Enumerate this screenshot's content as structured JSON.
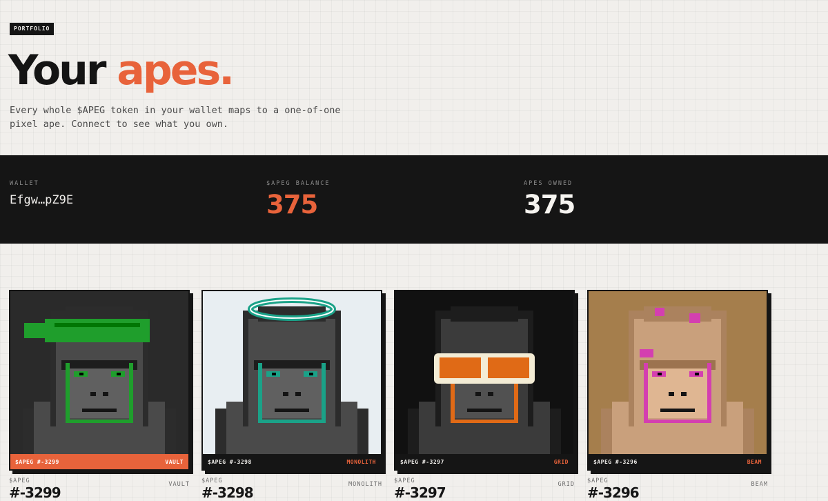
{
  "header": {
    "badge": "PORTFOLIO",
    "title_main": "Your ",
    "title_accent": "apes.",
    "subtitle": "Every whole $APEG token in your wallet maps to a one-of-one pixel ape. Connect to see what you own."
  },
  "stats": {
    "wallet_label": "WALLET",
    "wallet_value": "Efgw…pZ9E",
    "balance_label": "$APEG BALANCE",
    "balance_value": "375",
    "owned_label": "APES OWNED",
    "owned_value": "375"
  },
  "cards": [
    {
      "id": "$APEG #-3299",
      "trait": "VAULT",
      "meta_label": "$APEG",
      "meta_num": "#-3299",
      "meta_trait": "VAULT",
      "bg": "#2a2a2a",
      "fur": "#4a4a4a",
      "accent": "#1f9e2c",
      "accessory": "bandana",
      "selected": true
    },
    {
      "id": "$APEG #-3298",
      "trait": "MONOLITH",
      "meta_label": "$APEG",
      "meta_num": "#-3298",
      "meta_trait": "MONOLITH",
      "bg": "#e8eef2",
      "fur": "#4a4a4a",
      "accent": "#1aa288",
      "accessory": "halo",
      "selected": false
    },
    {
      "id": "$APEG #-3297",
      "trait": "GRID",
      "meta_label": "$APEG",
      "meta_num": "#-3297",
      "meta_trait": "GRID",
      "bg": "#111111",
      "fur": "#3b3b3b",
      "accent": "#e06a16",
      "accessory": "goggles",
      "selected": false
    },
    {
      "id": "$APEG #-3296",
      "trait": "BEAM",
      "meta_label": "$APEG",
      "meta_num": "#-3296",
      "meta_trait": "BEAM",
      "bg": "#a57e4c",
      "fur": "#c9a07c",
      "accent": "#d43fb0",
      "accessory": "warpaint",
      "selected": false
    }
  ],
  "colors": {
    "accent": "#e8633b",
    "dark": "#151515",
    "background": "#f1efec"
  }
}
